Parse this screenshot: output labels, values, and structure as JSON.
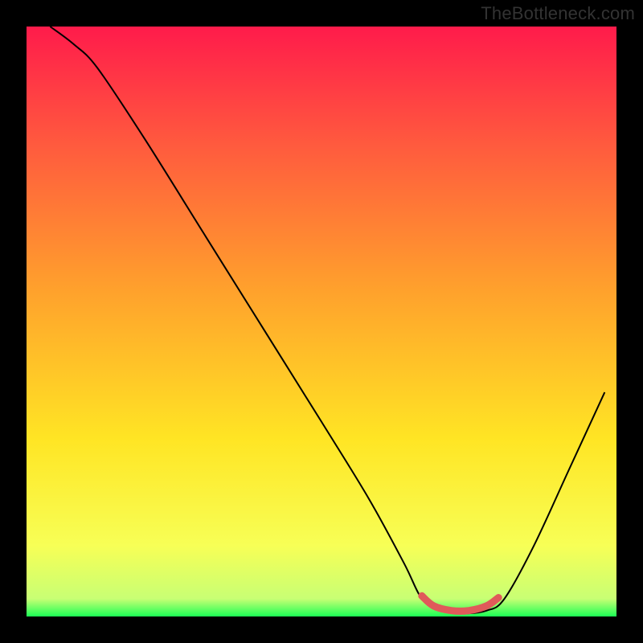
{
  "watermark": "TheBottleneck.com",
  "chart_data": {
    "type": "line",
    "title": "",
    "xlabel": "",
    "ylabel": "",
    "xlim": [
      0,
      100
    ],
    "ylim": [
      0,
      100
    ],
    "background_gradient": {
      "direction": "vertical",
      "stops": [
        {
          "pos": 0.0,
          "color": "#ff1b4b"
        },
        {
          "pos": 0.2,
          "color": "#ff5a3e"
        },
        {
          "pos": 0.45,
          "color": "#ffa22c"
        },
        {
          "pos": 0.7,
          "color": "#ffe524"
        },
        {
          "pos": 0.88,
          "color": "#f7ff56"
        },
        {
          "pos": 0.97,
          "color": "#c8ff74"
        },
        {
          "pos": 1.0,
          "color": "#1bff55"
        }
      ]
    },
    "series": [
      {
        "name": "bottleneck-curve",
        "color": "#000000",
        "stroke_width": 2,
        "points": [
          {
            "x": 4,
            "y": 100
          },
          {
            "x": 8,
            "y": 97
          },
          {
            "x": 12,
            "y": 93
          },
          {
            "x": 20,
            "y": 81
          },
          {
            "x": 30,
            "y": 65
          },
          {
            "x": 40,
            "y": 49
          },
          {
            "x": 50,
            "y": 33
          },
          {
            "x": 58,
            "y": 20
          },
          {
            "x": 64,
            "y": 9
          },
          {
            "x": 67,
            "y": 3
          },
          {
            "x": 70,
            "y": 1
          },
          {
            "x": 74,
            "y": 0.5
          },
          {
            "x": 78,
            "y": 1
          },
          {
            "x": 81,
            "y": 3
          },
          {
            "x": 86,
            "y": 12
          },
          {
            "x": 92,
            "y": 25
          },
          {
            "x": 98,
            "y": 38
          }
        ]
      },
      {
        "name": "optimal-range-marker",
        "color": "#e05a5a",
        "stroke_width": 9,
        "points": [
          {
            "x": 67,
            "y": 3.5
          },
          {
            "x": 69,
            "y": 1.8
          },
          {
            "x": 72,
            "y": 1.0
          },
          {
            "x": 75,
            "y": 1.0
          },
          {
            "x": 78,
            "y": 1.8
          },
          {
            "x": 80,
            "y": 3.2
          }
        ]
      }
    ]
  }
}
